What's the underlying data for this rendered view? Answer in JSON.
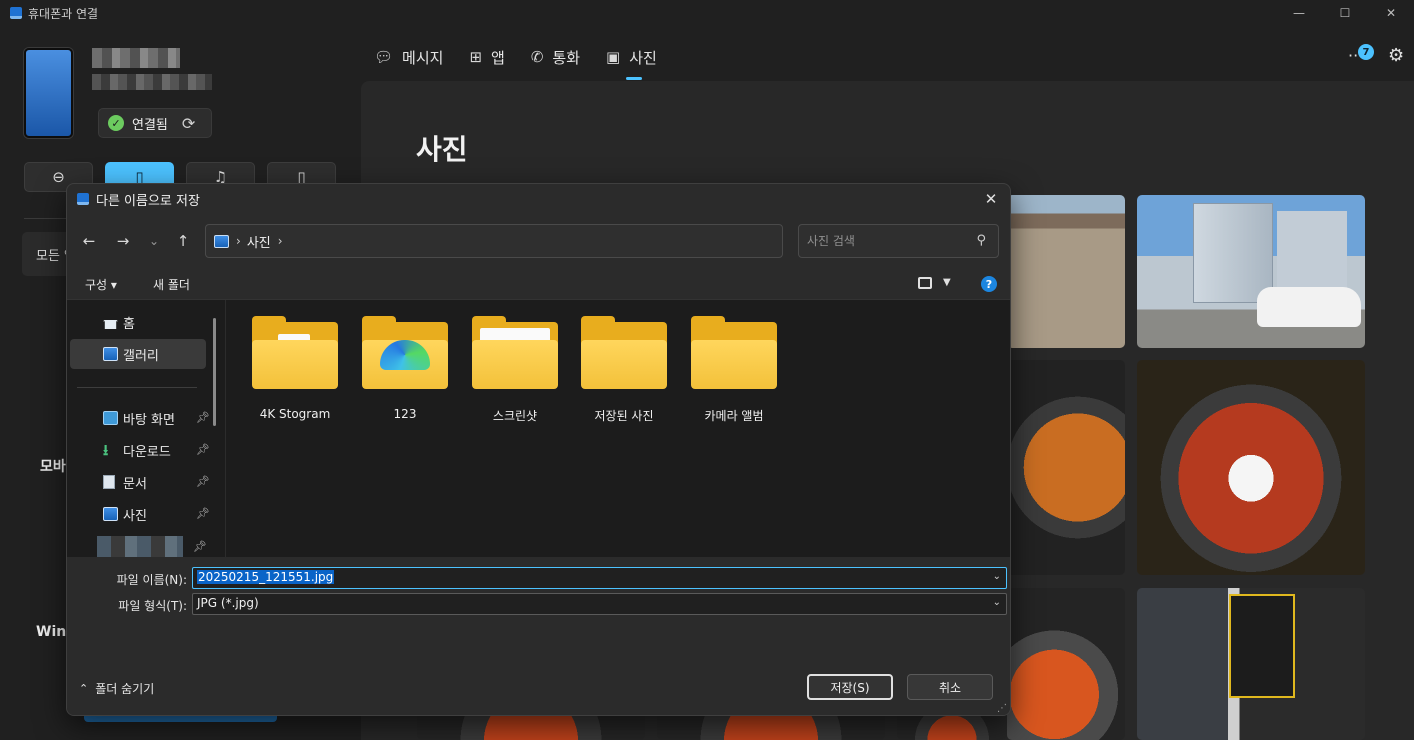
{
  "app": {
    "title": "휴대폰과 연결",
    "window_controls": {
      "minimize": "—",
      "maximize": "☐",
      "close": "✕"
    },
    "device": {
      "status": "연결됨"
    },
    "sidebar": {
      "card_label": "모든 앱",
      "section_1_fragment": "모바",
      "section_2_fragment": "Wind"
    },
    "nav_tabs": [
      {
        "label": "메시지",
        "icon": "message-icon"
      },
      {
        "label": "앱",
        "icon": "apps-icon"
      },
      {
        "label": "통화",
        "icon": "phone-icon"
      },
      {
        "label": "사진",
        "icon": "photo-icon"
      }
    ],
    "selected_tab": "사진",
    "notification_count": "7",
    "content_title": "사진",
    "accent": "#4cc2ff"
  },
  "dialog": {
    "title": "다른 이름으로 저장",
    "address": {
      "location": "사진"
    },
    "search": {
      "placeholder": "사진 검색"
    },
    "commands": {
      "organize": "구성",
      "new_folder": "새 폴더"
    },
    "nav_pane": [
      {
        "label": "홈",
        "icon": "home-icon",
        "pinned": false
      },
      {
        "label": "갤러리",
        "icon": "gallery-icon",
        "pinned": false,
        "selected": true
      },
      {
        "label": "바탕 화면",
        "icon": "desktop-icon",
        "pinned": true
      },
      {
        "label": "다운로드",
        "icon": "download-icon",
        "pinned": true
      },
      {
        "label": "문서",
        "icon": "document-icon",
        "pinned": true
      },
      {
        "label": "사진",
        "icon": "pictures-icon",
        "pinned": true
      }
    ],
    "folders": [
      {
        "label": "4K Stogram"
      },
      {
        "label": "123"
      },
      {
        "label": "스크린샷"
      },
      {
        "label": "저장된 사진"
      },
      {
        "label": "카메라 앨범"
      }
    ],
    "file_name": {
      "label": "파일 이름(N):",
      "value": "20250215_121551.jpg"
    },
    "file_type": {
      "label": "파일 형식(T):",
      "value": "JPG (*.jpg)"
    },
    "hide_folders_label": "폴더 숨기기",
    "save_button": "저장(S)",
    "cancel_button": "취소",
    "selection_color": "#0a64c8"
  }
}
